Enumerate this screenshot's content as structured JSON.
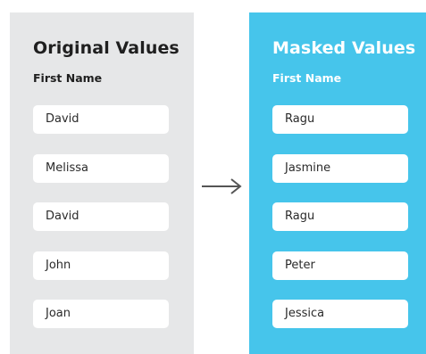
{
  "original": {
    "title": "Original Values",
    "column": "First Name",
    "values": [
      "David",
      "Melissa",
      "David",
      "John",
      "Joan"
    ]
  },
  "masked": {
    "title": "Masked Values",
    "column": "First Name",
    "values": [
      "Ragu",
      "Jasmine",
      "Ragu",
      "Peter",
      "Jessica"
    ]
  },
  "colors": {
    "original_panel": "#e6e7e8",
    "masked_panel": "#46c5eb",
    "arrow": "#555555"
  },
  "icons": {
    "arrow": "right-arrow-icon"
  }
}
